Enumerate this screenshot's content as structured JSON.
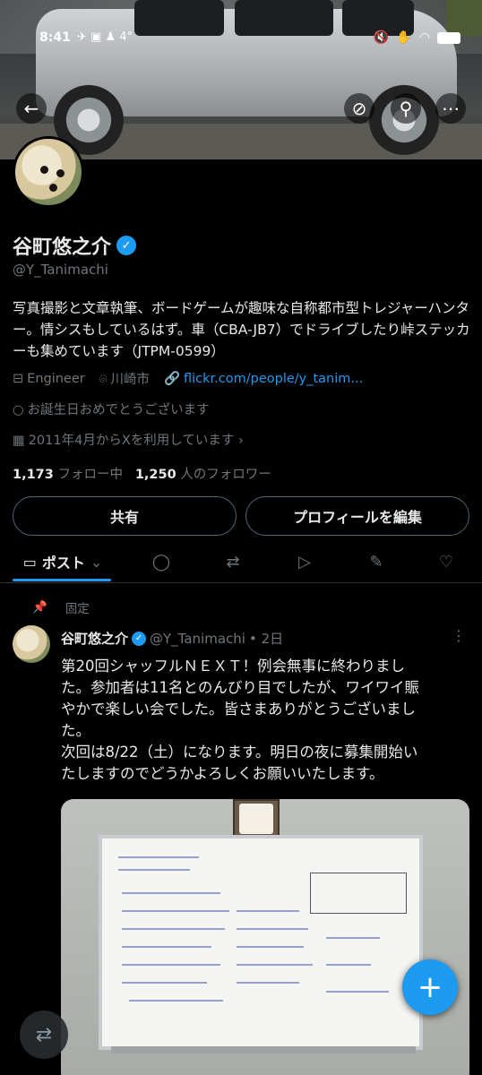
{
  "status_bar": {
    "time": "8:41",
    "left_icons": "✈ ▣ ♟ 4°",
    "right_icons": [
      "mute-icon",
      "hand-icon",
      "wifi-icon",
      "battery-icon"
    ]
  },
  "profile": {
    "name": "谷町悠之介",
    "handle": "@Y_Tanimachi",
    "bio": "写真撮影と文章執筆、ボードゲームが趣味な自称都市型トレジャーハンター。情シスもしているはず。車（CBA-JB7）でドライブしたり峠ステッカーも集めています（JTPM-0599）",
    "job": "Engineer",
    "location": "川崎市",
    "website": "flickr.com/people/y_tanim...",
    "birthday": "お誕生日おめでとうございます",
    "joined": "2011年4月からXを利用しています",
    "following_count": "1,173",
    "following_label": "フォロー中",
    "followers_count": "1,250",
    "followers_label": "人のフォロワー"
  },
  "buttons": {
    "share": "共有",
    "edit_profile": "プロフィールを編集"
  },
  "tabs": {
    "posts": "ポスト"
  },
  "pinned_label": "固定",
  "post": {
    "name": "谷町悠之介",
    "handle": "@Y_Tanimachi",
    "time": "• 2日",
    "text_lines": [
      "第20回シャッフルＮＥＸＴ！例会無事に終わりまし",
      "た。参加者は11名とのんびり目でしたが、ワイワイ賑",
      "やかで楽しい会でした。皆さまありがとうございまし",
      "た。",
      "次回は8/22（土）になります。明日の夜に募集開始い",
      "たしますのでどうかよろしくお願いいたします。"
    ]
  },
  "colors": {
    "accent": "#1d9bf0",
    "background": "#000000",
    "secondary_text": "#71767b",
    "border": "#2f3336"
  }
}
